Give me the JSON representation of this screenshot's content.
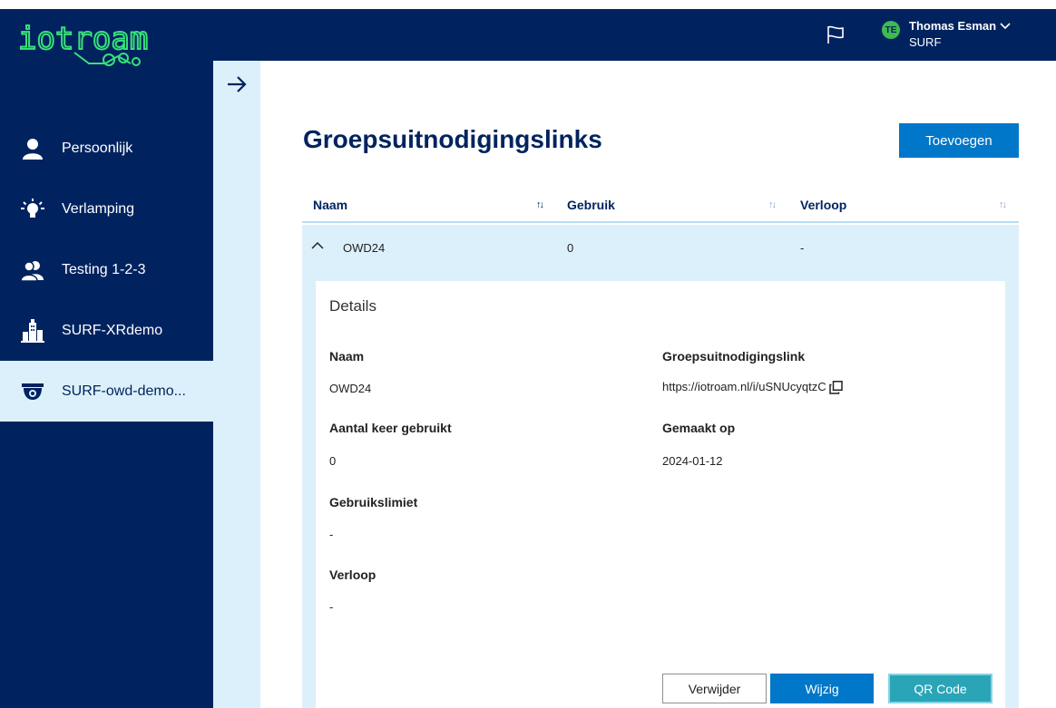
{
  "logo": {
    "text": "iotroam"
  },
  "sidebar": {
    "items": [
      {
        "label": "Persoonlijk",
        "icon": "person-icon"
      },
      {
        "label": "Verlamping",
        "icon": "lightbulb-icon"
      },
      {
        "label": "Testing 1-2-3",
        "icon": "group-icon"
      },
      {
        "label": "SURF-XRdemo",
        "icon": "building-icon"
      },
      {
        "label": "SURF-owd-demo...",
        "icon": "camera-icon",
        "active": true
      }
    ]
  },
  "header": {
    "user_initials": "TE",
    "user_name": "Thomas Esman",
    "user_org": "SURF"
  },
  "main": {
    "title": "Groepsuitnodigingslinks",
    "add_label": "Toevoegen",
    "table": {
      "columns": [
        "Naam",
        "Gebruik",
        "Verloop"
      ],
      "rows": [
        {
          "naam": "OWD24",
          "gebruik": "0",
          "verloop": "-"
        }
      ]
    },
    "details": {
      "title": "Details",
      "naam_label": "Naam",
      "naam_value": "OWD24",
      "link_label": "Groepsuitnodigingslink",
      "link_value": "https://iotroam.nl/i/uSNUcyqtzC",
      "usage_label": "Aantal keer gebruikt",
      "usage_value": "0",
      "created_label": "Gemaakt op",
      "created_value": "2024-01-12",
      "limit_label": "Gebruikslimiet",
      "limit_value": "-",
      "expiry_label": "Verloop",
      "expiry_value": "-"
    },
    "buttons": {
      "delete": "Verwijder",
      "edit": "Wijzig",
      "qr": "QR Code"
    }
  },
  "colors": {
    "navy": "#00235f",
    "primary": "#0077c8",
    "light": "#dcf0fb",
    "logo_green": "#39e07a",
    "qr": "#2aa5b8"
  }
}
